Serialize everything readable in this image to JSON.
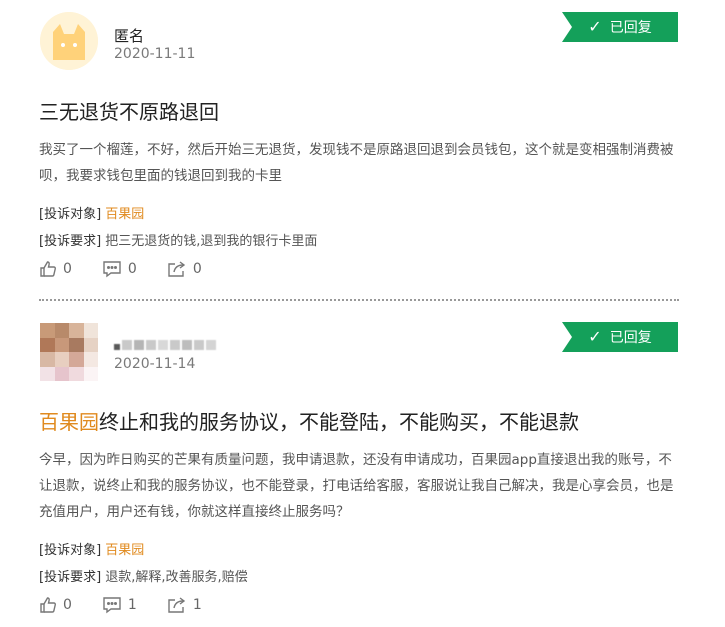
{
  "status_label": "已回复",
  "posts": [
    {
      "user": "匿名",
      "date": "2020-11-11",
      "title_prefix": "",
      "title_rest": "三无退货不原路退回",
      "body": "我买了一个榴莲，不好，然后开始三无退货，发现钱不是原路退回退到会员钱包，这个就是变相强制消费被呗，我要求钱包里面的钱退回到我的卡里",
      "target_tag": "[投诉对象]",
      "target_org": "百果园",
      "request_tag": "[投诉要求]",
      "request_text": "把三无退货的钱,退到我的银行卡里面",
      "likes": "0",
      "comments": "0",
      "shares": "0"
    },
    {
      "user": "",
      "date": "2020-11-14",
      "title_prefix": "百果园",
      "title_rest": "终止和我的服务协议，不能登陆，不能购买，不能退款",
      "body": "今早，因为昨日购买的芒果有质量问题，我申请退款，还没有申请成功，百果园app直接退出我的账号，不让退款，说终止和我的服务协议，也不能登录，打电话给客服，客服说让我自己解决，我是心享会员，也是充值用户，用户还有钱，你就这样直接终止服务吗？",
      "target_tag": "[投诉对象]",
      "target_org": "百果园",
      "request_tag": "[投诉要求]",
      "request_text": "退款,解释,改善服务,赔偿",
      "likes": "0",
      "comments": "1",
      "shares": "1"
    }
  ],
  "colors": {
    "badge": "#14a05a",
    "highlight": "#e08a1e"
  },
  "icons": {
    "status": "check-icon",
    "like": "thumbs-up-icon",
    "comment": "comment-icon",
    "share": "share-icon"
  }
}
